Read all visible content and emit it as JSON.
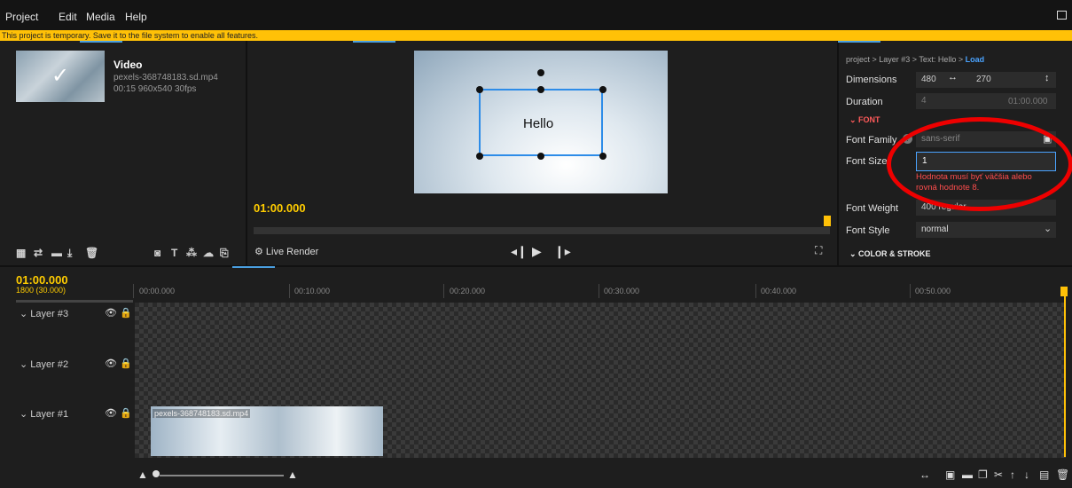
{
  "menu": [
    "Project",
    "Edit",
    "Media",
    "Help"
  ],
  "warning": "This project is temporary. Save it to the file system to enable all features.",
  "media": {
    "title": "Video",
    "filename": "pexels-368748183.sd.mp4",
    "meta": "00:15 960x540 30fps"
  },
  "preview": {
    "text": "Hello",
    "time": "01:00.000",
    "live_render": "Live Render"
  },
  "props": {
    "breadcrumb": "project > Layer #3 > Text: Hello > ",
    "breadcrumb_load": "Load",
    "dimensions_label": "Dimensions",
    "width": "480",
    "height": "270",
    "duration_label": "Duration",
    "duration_frames": "4",
    "duration_time": "01:00.000",
    "font_section": "FONT",
    "font_family_label": "Font Family",
    "font_family_value": "sans-serif",
    "font_size_label": "Font Size",
    "font_size_value": "1",
    "error": "Hodnota musí byť väčšia alebo rovná hodnote 8.",
    "font_weight_label": "Font Weight",
    "font_weight_value": "400 regular",
    "font_style_label": "Font Style",
    "font_style_value": "normal",
    "color_section": "COLOR & STROKE"
  },
  "timeline": {
    "time": "01:00.000",
    "frames": "1800 (30.000)",
    "ticks": [
      "00:00.000",
      "00:10.000",
      "00:20.000",
      "00:30.000",
      "00:40.000",
      "00:50.000"
    ],
    "layers": [
      "Layer #3",
      "Layer #2",
      "Layer #1"
    ],
    "clip_label": "pexels-368748183.sd.mp4"
  },
  "colors": {
    "accent": "#ffc107",
    "selection": "#2d8ce8",
    "error": "#ff4d4d"
  }
}
